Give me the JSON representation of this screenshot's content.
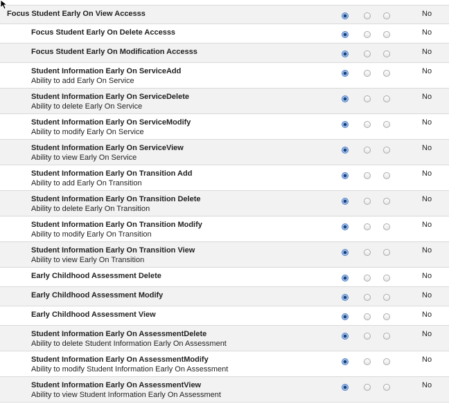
{
  "permissions": [
    {
      "title": "Focus Student Early On View Accesss",
      "description": "",
      "level": 0,
      "selected": 0,
      "value": "No"
    },
    {
      "title": "Focus Student Early On Delete Accesss",
      "description": "",
      "level": 1,
      "selected": 0,
      "value": "No"
    },
    {
      "title": "Focus Student Early On Modification Accesss",
      "description": "",
      "level": 1,
      "selected": 0,
      "value": "No"
    },
    {
      "title": "Student Information Early On ServiceAdd",
      "description": "Ability to add Early On Service",
      "level": 1,
      "selected": 0,
      "value": "No"
    },
    {
      "title": "Student Information Early On ServiceDelete",
      "description": "Ability to delete Early On Service",
      "level": 1,
      "selected": 0,
      "value": "No"
    },
    {
      "title": "Student Information Early On ServiceModify",
      "description": "Ability to modify Early On Service",
      "level": 1,
      "selected": 0,
      "value": "No"
    },
    {
      "title": "Student Information Early On ServiceView",
      "description": "Ability to view Early On Service",
      "level": 1,
      "selected": 0,
      "value": "No"
    },
    {
      "title": "Student Information Early On Transition Add",
      "description": "Ability to add Early On Transition",
      "level": 1,
      "selected": 0,
      "value": "No"
    },
    {
      "title": "Student Information Early On Transition Delete",
      "description": "Ability to delete Early On Transition",
      "level": 1,
      "selected": 0,
      "value": "No"
    },
    {
      "title": "Student Information Early On Transition Modify",
      "description": "Ability to modify Early On Transition",
      "level": 1,
      "selected": 0,
      "value": "No"
    },
    {
      "title": "Student Information Early On Transition View",
      "description": "Ability to view Early On Transition",
      "level": 1,
      "selected": 0,
      "value": "No"
    },
    {
      "title": "Early Childhood Assessment Delete",
      "description": "",
      "level": 1,
      "selected": 0,
      "value": "No"
    },
    {
      "title": "Early Childhood Assessment Modify",
      "description": "",
      "level": 1,
      "selected": 0,
      "value": "No"
    },
    {
      "title": "Early Childhood Assessment View",
      "description": "",
      "level": 1,
      "selected": 0,
      "value": "No"
    },
    {
      "title": "Student Information Early On AssessmentDelete",
      "description": "Ability to delete Student Information Early On Assessment",
      "level": 1,
      "selected": 0,
      "value": "No"
    },
    {
      "title": "Student Information Early On AssessmentModify",
      "description": "Ability to modify Student Information Early On Assessment",
      "level": 1,
      "selected": 0,
      "value": "No"
    },
    {
      "title": "Student Information Early On AssessmentView",
      "description": "Ability to view Student Information Early On Assessment",
      "level": 1,
      "selected": 0,
      "value": "No"
    }
  ],
  "colors": {
    "row_shaded": "#f2f2f2",
    "divider": "#d9d9d9",
    "radio_selected": "#4a7fc1"
  },
  "icons": {
    "cursor": "mouse-pointer-icon",
    "radio_checked": "radio-checked-icon",
    "radio_empty": "radio-empty-icon"
  }
}
